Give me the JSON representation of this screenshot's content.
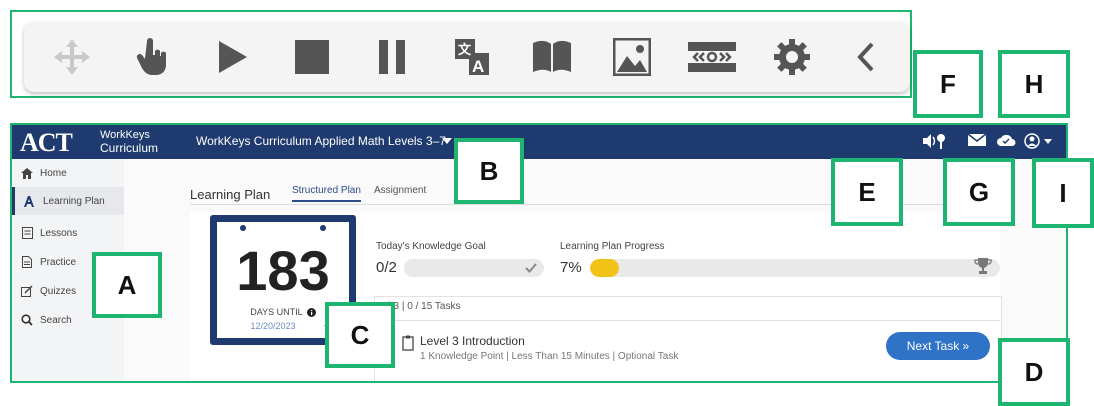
{
  "toolbar": {
    "icons": [
      "move-icon",
      "pointer-hand-icon",
      "play-icon",
      "stop-icon",
      "pause-icon",
      "translate-icon",
      "book-icon",
      "image-icon",
      "screen-mask-icon",
      "gear-icon",
      "chevron-left-icon"
    ]
  },
  "header": {
    "logo": "ACT",
    "brand_line1": "WorkKeys",
    "brand_line2": "Curriculum",
    "course_title": "WorkKeys Curriculum Applied Math Levels 3–7"
  },
  "sidebar": {
    "items": [
      {
        "label": "Home",
        "icon": "home-icon"
      },
      {
        "label": "Learning Plan",
        "icon": "learning-plan-icon"
      },
      {
        "label": "Lessons",
        "icon": "lessons-icon"
      },
      {
        "label": "Practice",
        "icon": "practice-icon"
      },
      {
        "label": "Quizzes",
        "icon": "quizzes-icon"
      },
      {
        "label": "Search",
        "icon": "search-icon"
      }
    ]
  },
  "main": {
    "title": "Learning Plan",
    "tabs": [
      {
        "label": "Structured Plan",
        "active": true
      },
      {
        "label": "Assignment",
        "active": false
      }
    ]
  },
  "days_card": {
    "count": "183",
    "label": "DAYS UNTIL",
    "date": "12/20/2023"
  },
  "goal": {
    "label": "Today's Knowledge Goal",
    "value": "0/2"
  },
  "progress": {
    "label": "Learning Plan Progress",
    "value": "7%",
    "percent": 7
  },
  "level": {
    "header": "vel 3 | 0 / 15 Tasks"
  },
  "task": {
    "title": "Level 3 Introduction",
    "meta": "1 Knowledge Point |  Less Than 15 Minutes | Optional Task",
    "button_label": "Next Task »"
  },
  "callouts": {
    "a": "A",
    "b": "B",
    "c": "C",
    "d": "D",
    "e": "E",
    "f": "F",
    "g": "G",
    "h": "H",
    "i": "I"
  },
  "colors": {
    "accent": "#1db56f",
    "header": "#1f3a6e",
    "progress": "#f2c418",
    "button": "#2f73c6"
  }
}
